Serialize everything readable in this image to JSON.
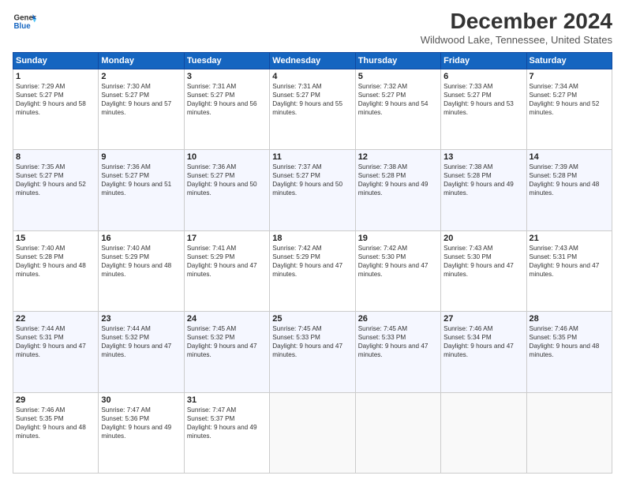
{
  "header": {
    "logo_line1": "General",
    "logo_line2": "Blue",
    "title": "December 2024",
    "subtitle": "Wildwood Lake, Tennessee, United States"
  },
  "columns": [
    "Sunday",
    "Monday",
    "Tuesday",
    "Wednesday",
    "Thursday",
    "Friday",
    "Saturday"
  ],
  "weeks": [
    [
      {
        "day": "1",
        "sunrise": "7:29 AM",
        "sunset": "5:27 PM",
        "daylight": "9 hours and 58 minutes."
      },
      {
        "day": "2",
        "sunrise": "7:30 AM",
        "sunset": "5:27 PM",
        "daylight": "9 hours and 57 minutes."
      },
      {
        "day": "3",
        "sunrise": "7:31 AM",
        "sunset": "5:27 PM",
        "daylight": "9 hours and 56 minutes."
      },
      {
        "day": "4",
        "sunrise": "7:31 AM",
        "sunset": "5:27 PM",
        "daylight": "9 hours and 55 minutes."
      },
      {
        "day": "5",
        "sunrise": "7:32 AM",
        "sunset": "5:27 PM",
        "daylight": "9 hours and 54 minutes."
      },
      {
        "day": "6",
        "sunrise": "7:33 AM",
        "sunset": "5:27 PM",
        "daylight": "9 hours and 53 minutes."
      },
      {
        "day": "7",
        "sunrise": "7:34 AM",
        "sunset": "5:27 PM",
        "daylight": "9 hours and 52 minutes."
      }
    ],
    [
      {
        "day": "8",
        "sunrise": "7:35 AM",
        "sunset": "5:27 PM",
        "daylight": "9 hours and 52 minutes."
      },
      {
        "day": "9",
        "sunrise": "7:36 AM",
        "sunset": "5:27 PM",
        "daylight": "9 hours and 51 minutes."
      },
      {
        "day": "10",
        "sunrise": "7:36 AM",
        "sunset": "5:27 PM",
        "daylight": "9 hours and 50 minutes."
      },
      {
        "day": "11",
        "sunrise": "7:37 AM",
        "sunset": "5:27 PM",
        "daylight": "9 hours and 50 minutes."
      },
      {
        "day": "12",
        "sunrise": "7:38 AM",
        "sunset": "5:28 PM",
        "daylight": "9 hours and 49 minutes."
      },
      {
        "day": "13",
        "sunrise": "7:38 AM",
        "sunset": "5:28 PM",
        "daylight": "9 hours and 49 minutes."
      },
      {
        "day": "14",
        "sunrise": "7:39 AM",
        "sunset": "5:28 PM",
        "daylight": "9 hours and 48 minutes."
      }
    ],
    [
      {
        "day": "15",
        "sunrise": "7:40 AM",
        "sunset": "5:28 PM",
        "daylight": "9 hours and 48 minutes."
      },
      {
        "day": "16",
        "sunrise": "7:40 AM",
        "sunset": "5:29 PM",
        "daylight": "9 hours and 48 minutes."
      },
      {
        "day": "17",
        "sunrise": "7:41 AM",
        "sunset": "5:29 PM",
        "daylight": "9 hours and 47 minutes."
      },
      {
        "day": "18",
        "sunrise": "7:42 AM",
        "sunset": "5:29 PM",
        "daylight": "9 hours and 47 minutes."
      },
      {
        "day": "19",
        "sunrise": "7:42 AM",
        "sunset": "5:30 PM",
        "daylight": "9 hours and 47 minutes."
      },
      {
        "day": "20",
        "sunrise": "7:43 AM",
        "sunset": "5:30 PM",
        "daylight": "9 hours and 47 minutes."
      },
      {
        "day": "21",
        "sunrise": "7:43 AM",
        "sunset": "5:31 PM",
        "daylight": "9 hours and 47 minutes."
      }
    ],
    [
      {
        "day": "22",
        "sunrise": "7:44 AM",
        "sunset": "5:31 PM",
        "daylight": "9 hours and 47 minutes."
      },
      {
        "day": "23",
        "sunrise": "7:44 AM",
        "sunset": "5:32 PM",
        "daylight": "9 hours and 47 minutes."
      },
      {
        "day": "24",
        "sunrise": "7:45 AM",
        "sunset": "5:32 PM",
        "daylight": "9 hours and 47 minutes."
      },
      {
        "day": "25",
        "sunrise": "7:45 AM",
        "sunset": "5:33 PM",
        "daylight": "9 hours and 47 minutes."
      },
      {
        "day": "26",
        "sunrise": "7:45 AM",
        "sunset": "5:33 PM",
        "daylight": "9 hours and 47 minutes."
      },
      {
        "day": "27",
        "sunrise": "7:46 AM",
        "sunset": "5:34 PM",
        "daylight": "9 hours and 47 minutes."
      },
      {
        "day": "28",
        "sunrise": "7:46 AM",
        "sunset": "5:35 PM",
        "daylight": "9 hours and 48 minutes."
      }
    ],
    [
      {
        "day": "29",
        "sunrise": "7:46 AM",
        "sunset": "5:35 PM",
        "daylight": "9 hours and 48 minutes."
      },
      {
        "day": "30",
        "sunrise": "7:47 AM",
        "sunset": "5:36 PM",
        "daylight": "9 hours and 49 minutes."
      },
      {
        "day": "31",
        "sunrise": "7:47 AM",
        "sunset": "5:37 PM",
        "daylight": "9 hours and 49 minutes."
      },
      null,
      null,
      null,
      null
    ]
  ],
  "labels": {
    "sunrise": "Sunrise: ",
    "sunset": "Sunset: ",
    "daylight": "Daylight: "
  }
}
